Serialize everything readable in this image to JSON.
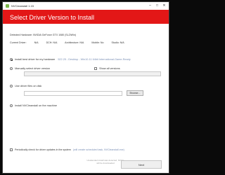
{
  "window": {
    "title": "NVCleanstall 1.15",
    "controls": {
      "minimize": "–",
      "maximize": "□",
      "close": "✕"
    }
  },
  "header": {
    "title": "Select Driver Version to Install"
  },
  "info": {
    "detected_hardware": "Detected Hardware: NVIDIA GeForce GTX 1080 (SL2\\Win)",
    "current_driver": "Current Driver:",
    "current_driver_version": "N/A",
    "dch": "DCH: N/A",
    "architecture": "Architecture: N/A",
    "mobile": "Mobile: No",
    "studio": "Studio: N/A"
  },
  "options": {
    "install_internet_label": "Install best driver for my hardware",
    "install_internet_detail": "522.25 - Desktop - Win10-11 64bit International-Game-Ready",
    "identify_label": "Manually select driver version",
    "show_all_label": "Show all versions",
    "version_field_value": "",
    "local_label": "Use driver files on disk",
    "local_path_value": "",
    "browse_label": "Browse...",
    "install_latest_label": "Install NVCleanstall on the machine",
    "periodic_label": "Periodically check for driver updates in the system",
    "periodic_detail": "(will create scheduled task, NVCleanstall.exe)"
  },
  "footer": {
    "note": "Unattended install was detected, NVidia will be downloaded",
    "next_label": "Next"
  },
  "colors": {
    "accent": "#e31717",
    "app_icon": "#7ab648"
  }
}
